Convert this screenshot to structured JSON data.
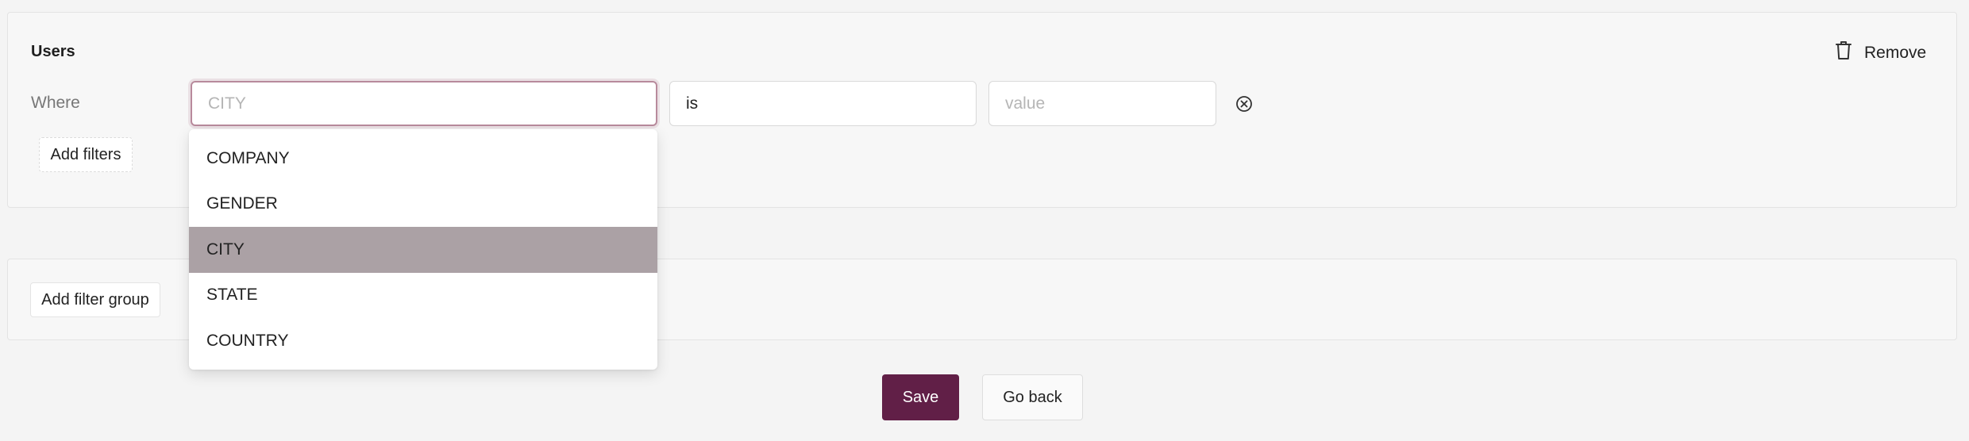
{
  "filter_group": {
    "title": "Users",
    "remove_label": "Remove",
    "where_label": "Where",
    "column_field": {
      "value": "",
      "placeholder": "CITY"
    },
    "operator_field": {
      "value": "is",
      "placeholder": ""
    },
    "value_field": {
      "value": "",
      "placeholder": "value"
    },
    "add_filters_label": "Add filters"
  },
  "column_dropdown": {
    "options": [
      "COMPANY",
      "GENDER",
      "CITY",
      "STATE",
      "COUNTRY"
    ],
    "selected": "CITY"
  },
  "add_filter_group_label": "Add filter group",
  "actions": {
    "save_label": "Save",
    "back_label": "Go back"
  },
  "colors": {
    "primary": "#611f47",
    "highlight": "#aba1a5",
    "focus_border": "#b88a9c"
  }
}
